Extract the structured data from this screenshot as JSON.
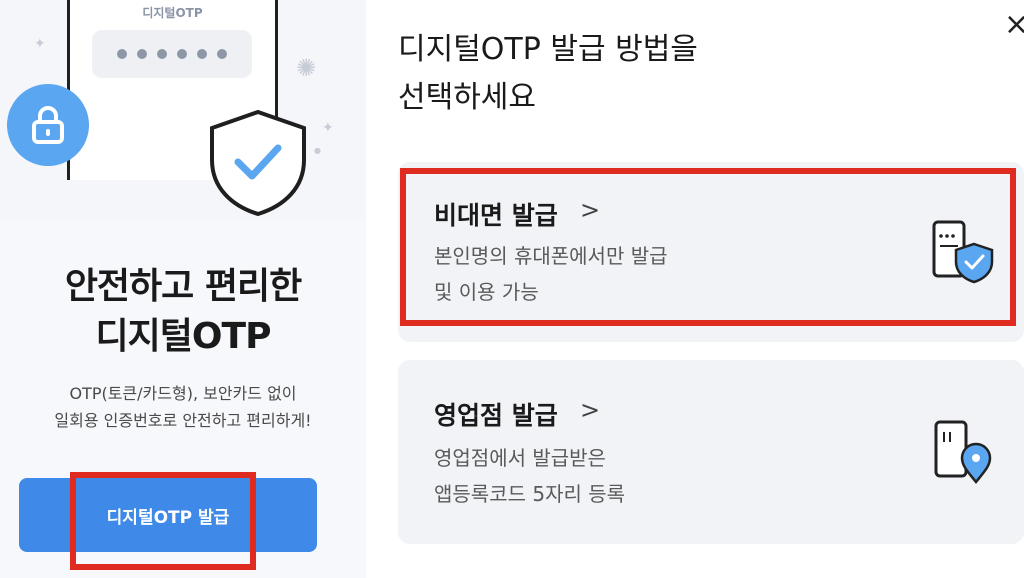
{
  "left_panel": {
    "illustration_label": "디지털OTP",
    "pin_dots": 6,
    "title_line1": "안전하고 편리한",
    "title_line2": "디지털OTP",
    "subtitle_line1": "OTP(토큰/카드형), 보안카드 없이",
    "subtitle_line2": "일회용 인증번호로 안전하고 편리하게!",
    "issue_button_label": "디지털OTP 발급"
  },
  "right_panel": {
    "title_line1": "디지털OTP 발급 방법을",
    "title_line2": "선택하세요",
    "close_icon": "×",
    "options": [
      {
        "title": "비대면 발급",
        "chevron": ">",
        "desc_line1": "본인명의 휴대폰에서만 발급",
        "desc_line2": "및 이용 가능",
        "icon": "phone-shield-icon"
      },
      {
        "title": "영업점 발급",
        "chevron": ">",
        "desc_line1": "영업점에서 발급받은",
        "desc_line2": "앱등록코드 5자리 등록",
        "icon": "phone-location-icon"
      }
    ]
  },
  "colors": {
    "primary_blue": "#3f8ae8",
    "highlight_red": "#e02b20",
    "card_bg": "#f1f3f7"
  }
}
